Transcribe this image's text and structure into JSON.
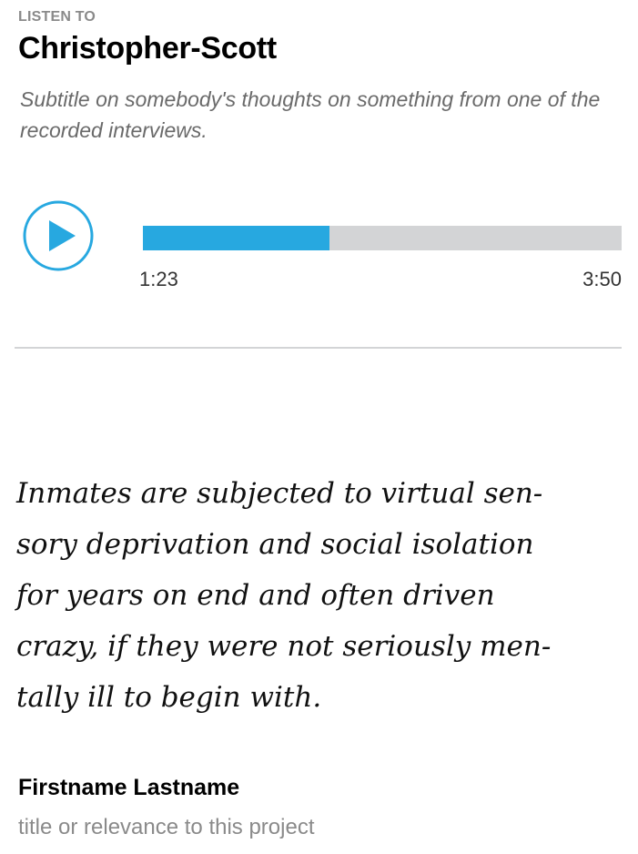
{
  "header": {
    "eyebrow": "LISTEN TO",
    "title": "Christopher-Scott",
    "subtitle": "Subtitle on somebody's thoughts on something from one of the recorded interviews."
  },
  "player": {
    "play_icon": "play-icon",
    "current_time": "1:23",
    "total_time": "3:50",
    "progress_fraction": 0.39,
    "colors": {
      "accent": "#27a8e0",
      "track": "#d3d4d6"
    }
  },
  "quote": {
    "lines": [
      "Inmates are subjected to virtual sen-",
      "sory deprivation and social isolation",
      "for years on end and often driven",
      "crazy, if they were not seriously men-",
      "tally ill to begin with."
    ]
  },
  "attribution": {
    "name": "Firstname Lastname",
    "role": "title or relevance to this project"
  }
}
